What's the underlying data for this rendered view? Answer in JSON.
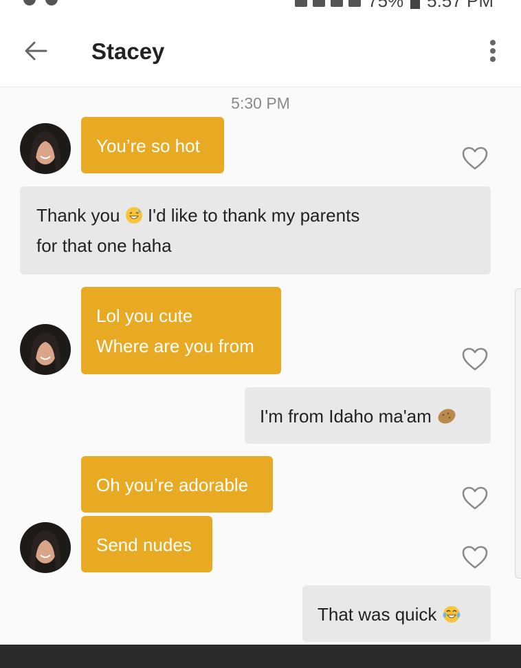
{
  "status_bar": {
    "battery": "75%",
    "time": "5:57 PM"
  },
  "header": {
    "title": "Stacey"
  },
  "chat": {
    "timestamp": "5:30 PM",
    "messages": [
      {
        "side": "in",
        "text": "You’re so hot"
      },
      {
        "side": "out",
        "text_before": "Thank you",
        "text_after": "I'd like to thank my parents",
        "line2": "for that one haha",
        "emoji": "grinning-sweat-emoji"
      },
      {
        "side": "in",
        "line1": "Lol you cute",
        "line2": "Where are you from"
      },
      {
        "side": "out",
        "text": "I'm from Idaho ma'am",
        "emoji": "potato-emoji"
      },
      {
        "side": "in",
        "text": "Oh you’re adorable"
      },
      {
        "side": "in",
        "text": "Send nudes"
      },
      {
        "side": "out",
        "text": "That was quick",
        "emoji": "tears-of-joy-emoji"
      }
    ]
  },
  "colors": {
    "incoming_bubble": "#e8aa22",
    "outgoing_bubble": "#e8e8e8",
    "accent_text": "#ffffff"
  },
  "icons": {
    "back": "arrow-left-icon",
    "menu": "more-vert-icon",
    "like": "heart-outline-icon"
  }
}
